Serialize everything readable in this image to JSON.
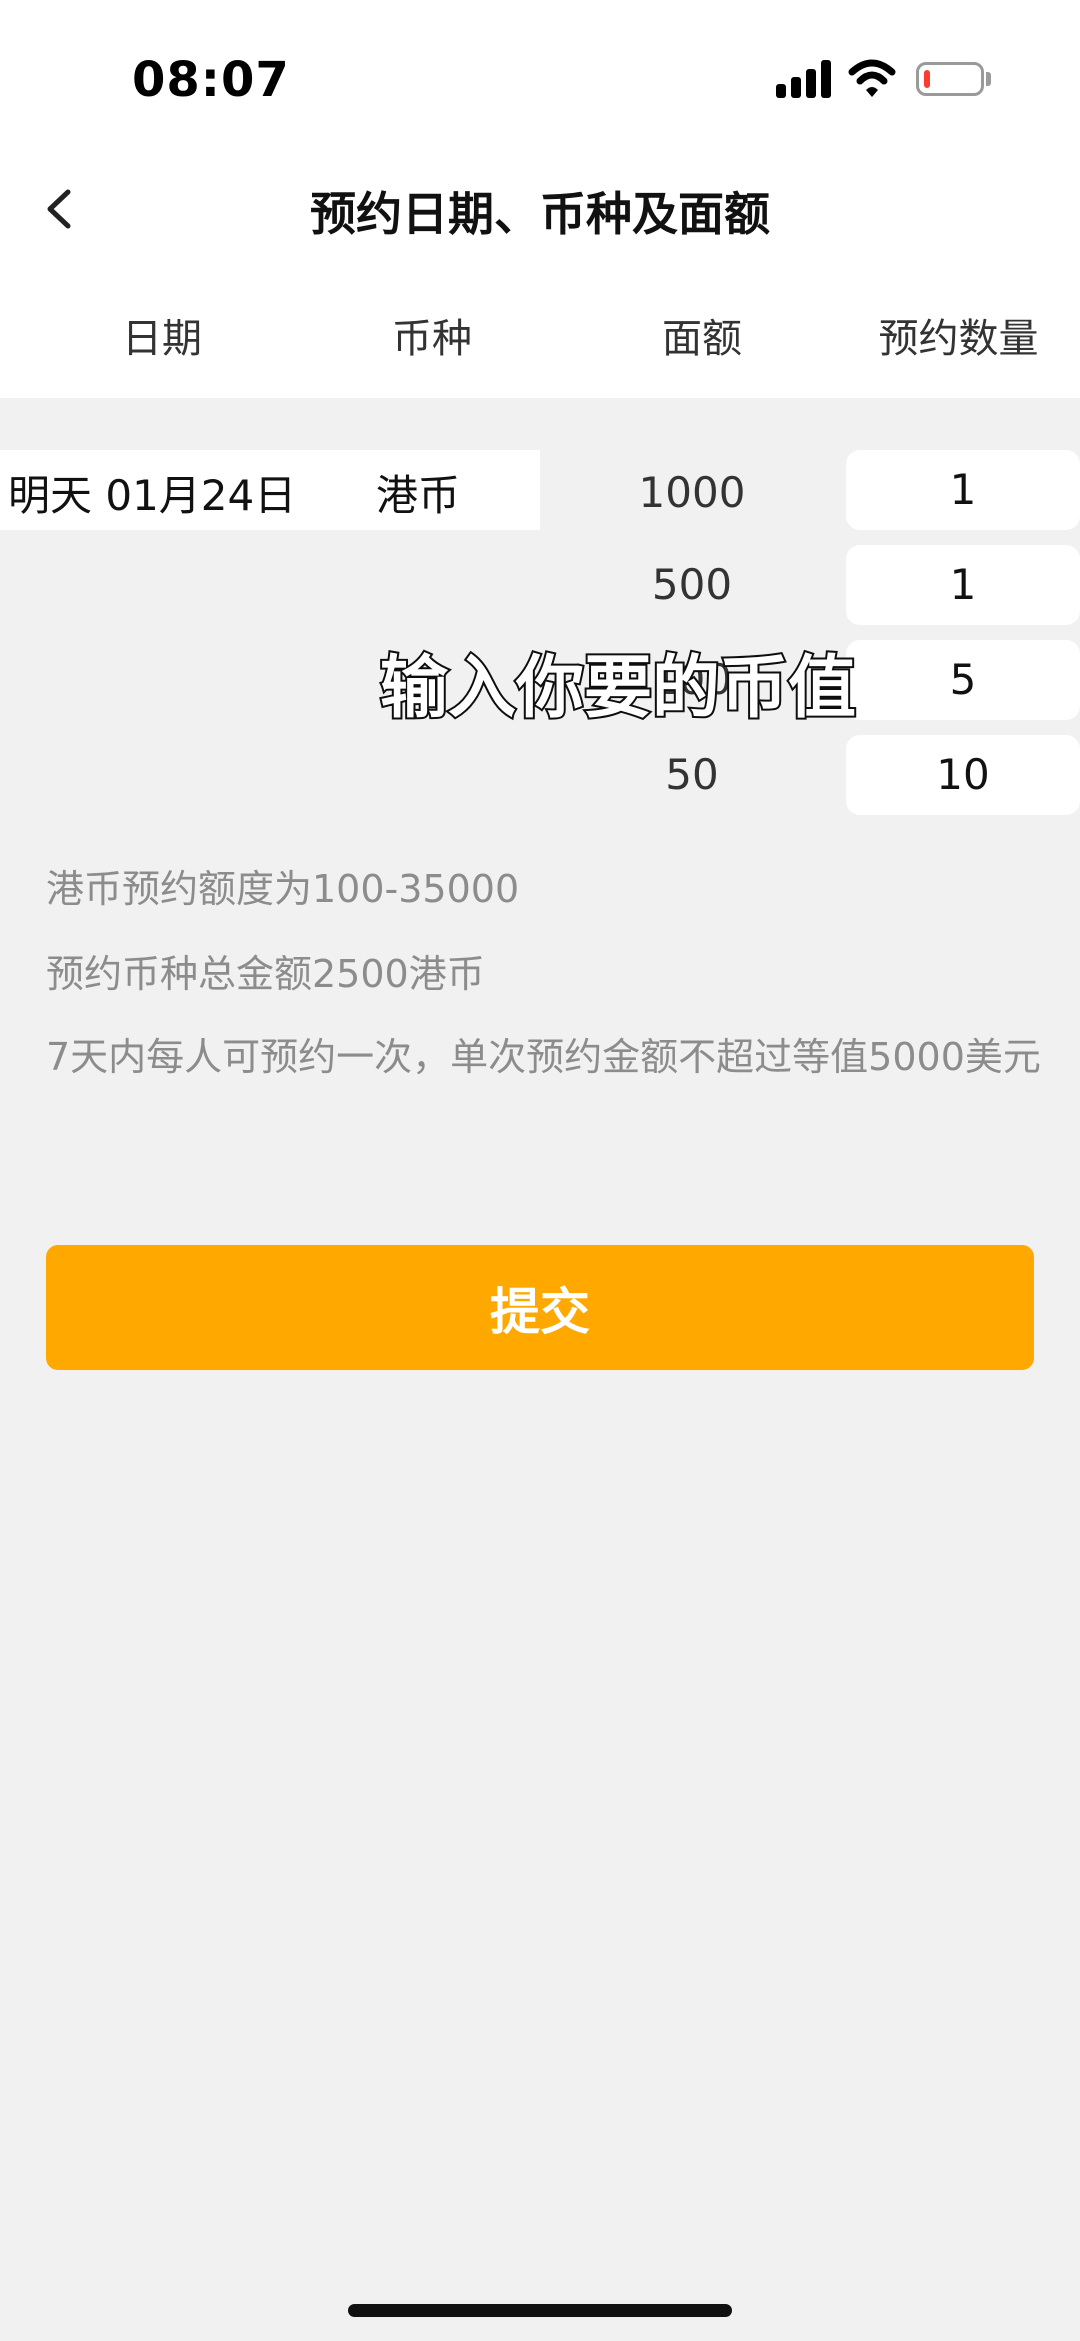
{
  "status_bar": {
    "time": "08:07"
  },
  "header": {
    "title": "预约日期、币种及面额"
  },
  "columns": [
    "日期",
    "币种",
    "面额",
    "预约数量"
  ],
  "selection": {
    "date": "明天 01月24日",
    "currency": "港币"
  },
  "rows": [
    {
      "denomination": "1000",
      "quantity": "1"
    },
    {
      "denomination": "500",
      "quantity": "1"
    },
    {
      "denomination": "100",
      "quantity": "5"
    },
    {
      "denomination": "50",
      "quantity": "10"
    }
  ],
  "overlay_caption": "输入你要的币值",
  "info": {
    "limit": "港币预约额度为100-35000",
    "total": "预约币种总金额2500港币",
    "rule": "7天内每人可预约一次，单次预约金额不超过等值5000美元"
  },
  "submit_label": "提交",
  "colors": {
    "accent": "#ffa800",
    "battery_low": "#ff3b30"
  },
  "icons": [
    "cellular-signal-icon",
    "wifi-icon",
    "battery-icon",
    "back-arrow-icon"
  ]
}
